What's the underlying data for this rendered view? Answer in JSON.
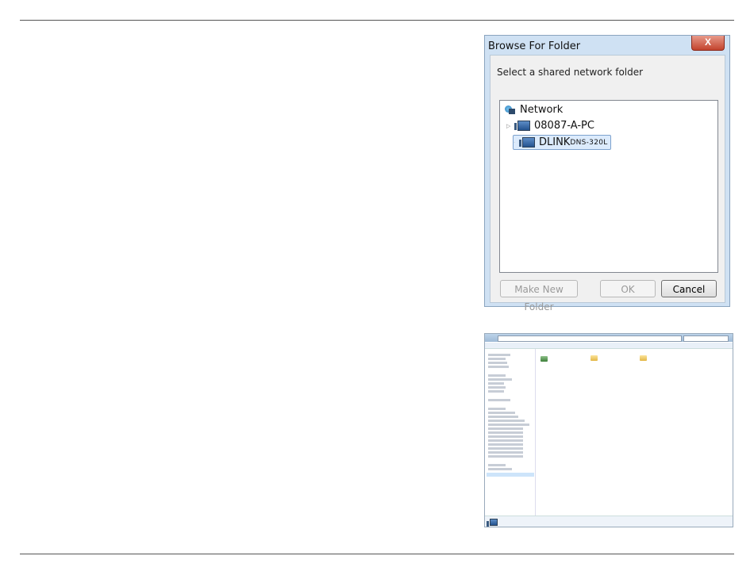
{
  "dialog": {
    "title": "Browse For Folder",
    "close_glyph": "X",
    "instruction": "Select a shared network folder",
    "tree": {
      "root": "Network",
      "items": [
        {
          "label": "08087-A-PC",
          "suffix": ""
        },
        {
          "label": "DLINK",
          "suffix": "DNS-320L"
        }
      ]
    },
    "buttons": {
      "make_new_folder": "Make New Folder",
      "ok": "OK",
      "cancel": "Cancel"
    }
  },
  "explorer": {
    "icons": [
      "network-icon",
      "folder-icon",
      "computer-icon"
    ]
  }
}
